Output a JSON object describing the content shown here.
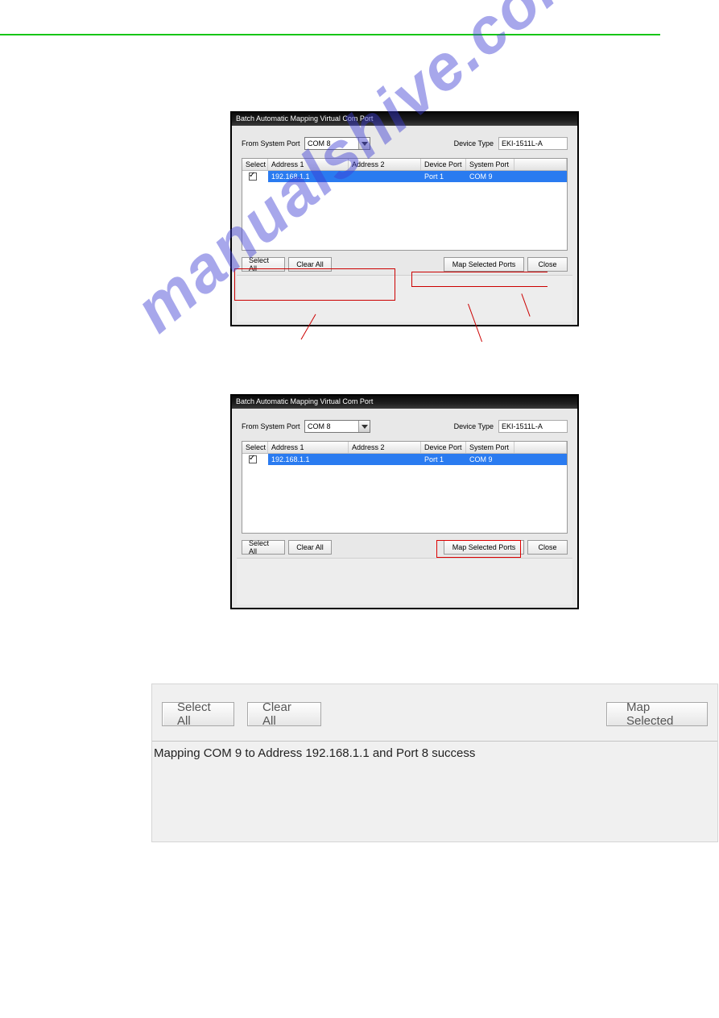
{
  "dialog": {
    "title": "Batch Automatic Mapping Virtual Com Port",
    "from_system_port_label": "From System Port",
    "from_system_port_value": "COM 8",
    "device_type_label": "Device Type",
    "device_type_value": "EKI-1511L-A",
    "headers": {
      "select": "Select",
      "addr1": "Address 1",
      "addr2": "Address 2",
      "devport": "Device Port",
      "sysport": "System Port"
    },
    "row": {
      "addr1": "192.168.1.1",
      "addr2": "",
      "devport": "Port 1",
      "sysport": "COM 9"
    },
    "buttons": {
      "select_all": "Select All",
      "clear_all": "Clear All",
      "map": "Map Selected Ports",
      "close": "Close"
    }
  },
  "crop": {
    "select_all": "Select All",
    "clear_all": "Clear All",
    "map": "Map Selected",
    "status": "Mapping COM 9 to Address 192.168.1.1 and Port 8 success"
  },
  "watermark": "manualshive.com"
}
